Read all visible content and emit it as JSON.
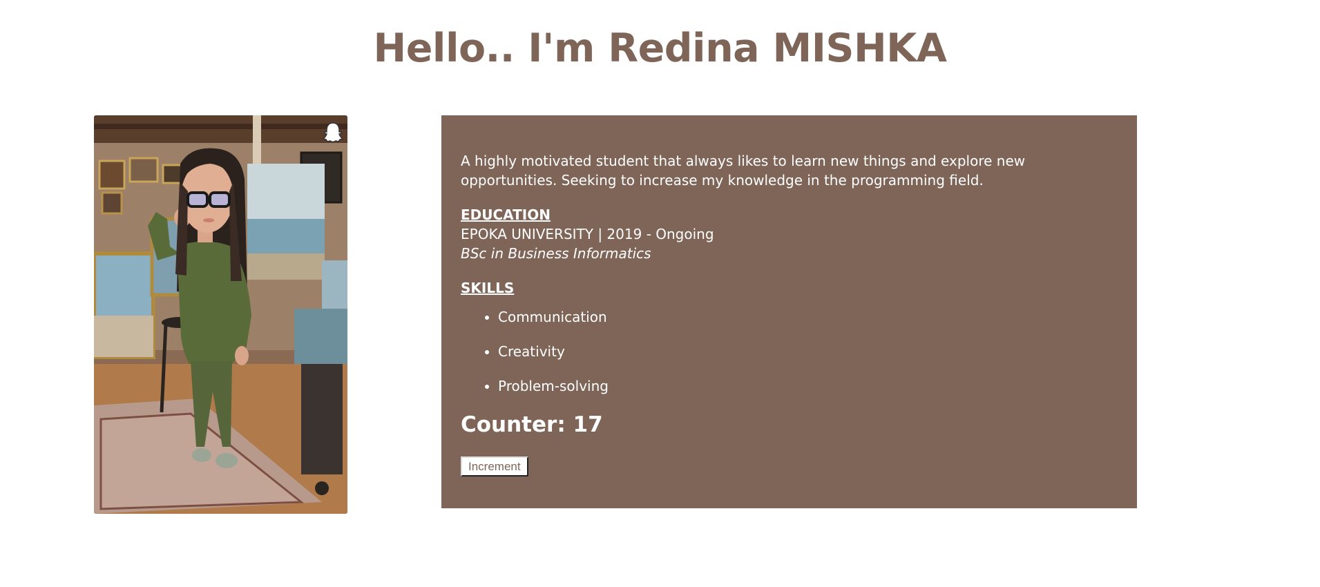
{
  "header": {
    "title": "Hello.. I'm Redina MISHKA"
  },
  "profile": {
    "image_alt": "Bitmoji avatar in a painter's studio",
    "badge_icon": "snapchat-ghost-icon"
  },
  "about": {
    "intro": "A highly motivated student that always likes to learn new things and explore new opportunities. Seeking to increase my knowledge in the programming field.",
    "education_heading": "EDUCATION",
    "education_line": "EPOKA UNIVERSITY | 2019 - Ongoing",
    "education_degree": "BSc in Business Informatics",
    "skills_heading": "SKILLS",
    "skills": [
      "Communication",
      "Creativity",
      "Problem-solving"
    ]
  },
  "counter": {
    "label": "Counter: 17",
    "button_label": "Increment"
  },
  "colors": {
    "accent": "#7e6558",
    "panel_text": "#ffffff",
    "background": "#ffffff"
  }
}
